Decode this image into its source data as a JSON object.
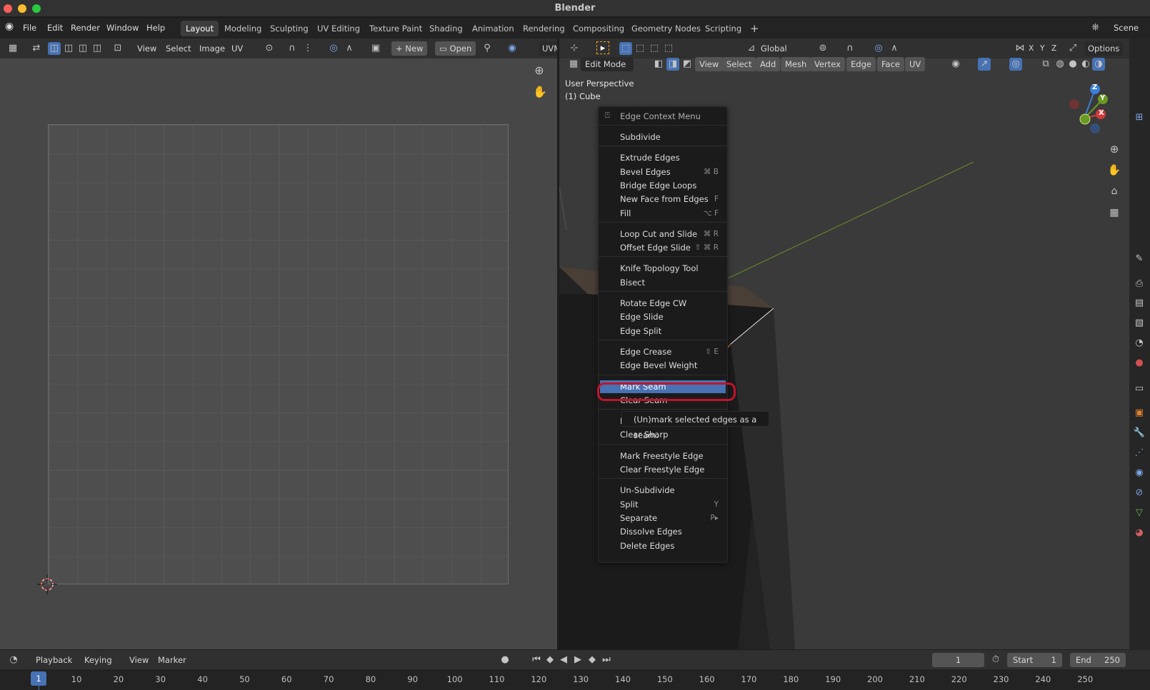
{
  "app": {
    "title": "Blender"
  },
  "menubar": {
    "items": [
      "File",
      "Edit",
      "Render",
      "Window",
      "Help"
    ],
    "workspaces": [
      "Layout",
      "Modeling",
      "Sculpting",
      "UV Editing",
      "Texture Paint",
      "Shading",
      "Animation",
      "Rendering",
      "Compositing",
      "Geometry Nodes",
      "Scripting"
    ],
    "add_tab": "+",
    "scene": "Scene"
  },
  "uv_header": {
    "menus": [
      "View",
      "Select",
      "Image",
      "UV"
    ],
    "new_label": "New",
    "open_label": "Open",
    "uvmap": "UVM"
  },
  "viewport_header": {
    "orientation": "Global",
    "options": "Options",
    "axes": [
      "X",
      "Y",
      "Z"
    ]
  },
  "viewport_header2": {
    "mode": "Edit Mode",
    "menus": [
      "View",
      "Select",
      "Add",
      "Mesh",
      "Vertex",
      "Edge",
      "Face",
      "UV"
    ]
  },
  "viewport": {
    "perspective": "User Perspective",
    "object": "(1) Cube",
    "gizmo": {
      "x": "X",
      "y": "Y",
      "z": "Z"
    }
  },
  "context_menu": {
    "title": "Edge Context Menu",
    "sections": [
      [
        {
          "label": "Subdivide",
          "shortcut": ""
        }
      ],
      [
        {
          "label": "Extrude Edges",
          "shortcut": ""
        },
        {
          "label": "Bevel Edges",
          "shortcut": "⌘ B"
        },
        {
          "label": "Bridge Edge Loops",
          "shortcut": ""
        },
        {
          "label": "New Face from Edges",
          "shortcut": "F"
        },
        {
          "label": "Fill",
          "shortcut": "⌥ F"
        }
      ],
      [
        {
          "label": "Loop Cut and Slide",
          "shortcut": "⌘ R"
        },
        {
          "label": "Offset Edge Slide",
          "shortcut": "⇧ ⌘ R"
        }
      ],
      [
        {
          "label": "Knife Topology Tool",
          "shortcut": ""
        },
        {
          "label": "Bisect",
          "shortcut": ""
        }
      ],
      [
        {
          "label": "Rotate Edge CW",
          "shortcut": ""
        },
        {
          "label": "Edge Slide",
          "shortcut": ""
        },
        {
          "label": "Edge Split",
          "shortcut": ""
        }
      ],
      [
        {
          "label": "Edge Crease",
          "shortcut": "⇧ E"
        },
        {
          "label": "Edge Bevel Weight",
          "shortcut": ""
        }
      ],
      [
        {
          "label": "Mark Seam",
          "shortcut": ""
        },
        {
          "label": "Clear Seam",
          "shortcut": ""
        }
      ],
      [
        {
          "label": "Mark Sharp",
          "shortcut": ""
        },
        {
          "label": "Clear Sharp",
          "shortcut": ""
        }
      ],
      [
        {
          "label": "Mark Freestyle Edge",
          "shortcut": ""
        },
        {
          "label": "Clear Freestyle Edge",
          "shortcut": ""
        }
      ],
      [
        {
          "label": "Un-Subdivide",
          "shortcut": ""
        },
        {
          "label": "Split",
          "shortcut": "Y"
        },
        {
          "label": "Separate",
          "shortcut": "P▸"
        },
        {
          "label": "Dissolve Edges",
          "shortcut": ""
        },
        {
          "label": "Delete Edges",
          "shortcut": ""
        }
      ]
    ],
    "highlighted": "Mark Seam",
    "highlight_color": "#4772b3",
    "annotation_color": "#c0142c"
  },
  "tooltip": {
    "text": "(Un)mark selected edges as a seam."
  },
  "timeline": {
    "menus": [
      "Playback",
      "Keying",
      "View",
      "Marker"
    ],
    "current_frame": "1",
    "start_label": "Start",
    "start": "1",
    "end_label": "End",
    "end": "250",
    "ticks": [
      "1",
      "10",
      "20",
      "30",
      "40",
      "50",
      "60",
      "70",
      "80",
      "90",
      "100",
      "110",
      "120",
      "130",
      "140",
      "150",
      "160",
      "170",
      "180",
      "190",
      "200",
      "210",
      "220",
      "230",
      "240",
      "250"
    ]
  }
}
